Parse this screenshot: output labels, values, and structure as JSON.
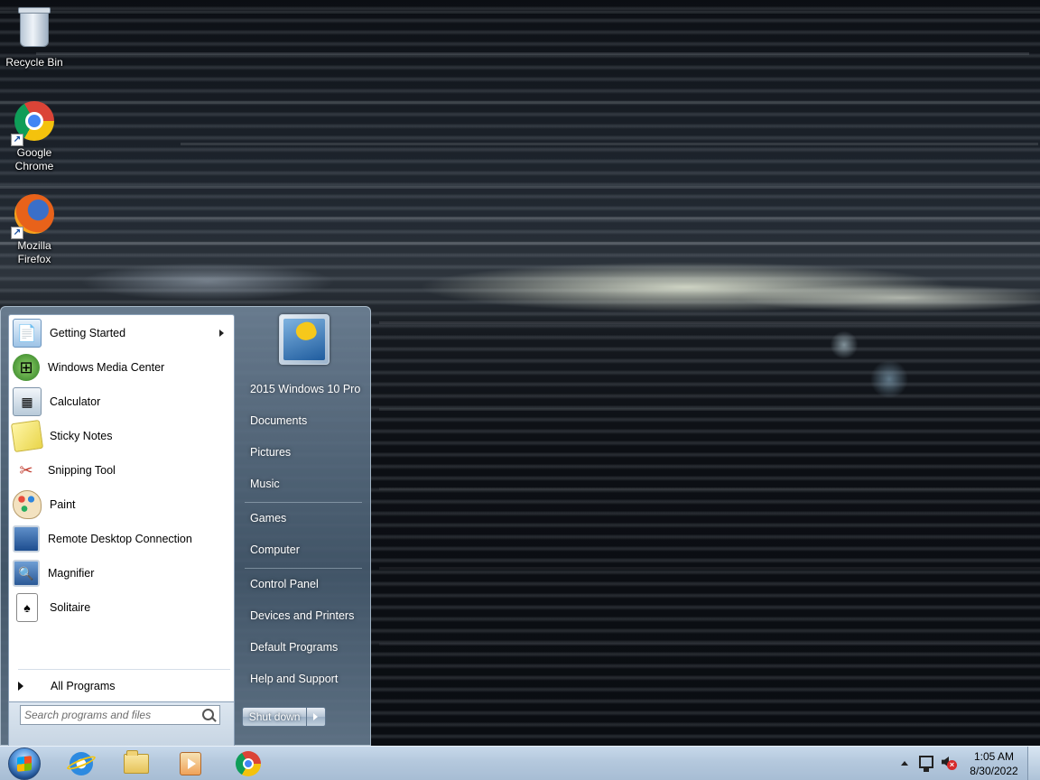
{
  "desktop": {
    "icons": [
      {
        "label": "Recycle Bin",
        "icon": "recycle-bin-icon"
      },
      {
        "label": "Google Chrome",
        "icon": "chrome-icon"
      },
      {
        "label": "Mozilla Firefox",
        "icon": "firefox-icon"
      }
    ]
  },
  "start_menu": {
    "programs": [
      {
        "label": "Getting Started",
        "icon": "getting-started-icon",
        "has_submenu": true
      },
      {
        "label": "Windows Media Center",
        "icon": "media-center-icon"
      },
      {
        "label": "Calculator",
        "icon": "calculator-icon"
      },
      {
        "label": "Sticky Notes",
        "icon": "sticky-notes-icon"
      },
      {
        "label": "Snipping Tool",
        "icon": "snipping-tool-icon"
      },
      {
        "label": "Paint",
        "icon": "paint-icon"
      },
      {
        "label": "Remote Desktop Connection",
        "icon": "remote-desktop-icon"
      },
      {
        "label": "Magnifier",
        "icon": "magnifier-icon"
      },
      {
        "label": "Solitaire",
        "icon": "solitaire-icon"
      }
    ],
    "all_programs_label": "All Programs",
    "search_placeholder": "Search programs and files",
    "right_items": [
      {
        "label": "2015 Windows 10 Pro"
      },
      {
        "label": "Documents"
      },
      {
        "label": "Pictures"
      },
      {
        "label": "Music"
      },
      {
        "label": "Games"
      },
      {
        "label": "Computer"
      },
      {
        "label": "Control Panel"
      },
      {
        "label": "Devices and Printers"
      },
      {
        "label": "Default Programs"
      },
      {
        "label": "Help and Support"
      }
    ],
    "shutdown_label": "Shut down"
  },
  "taskbar": {
    "pinned": [
      "internet-explorer-icon",
      "windows-explorer-icon",
      "media-player-icon",
      "chrome-icon"
    ],
    "clock_time": "1:05 AM",
    "clock_date": "8/30/2022"
  }
}
